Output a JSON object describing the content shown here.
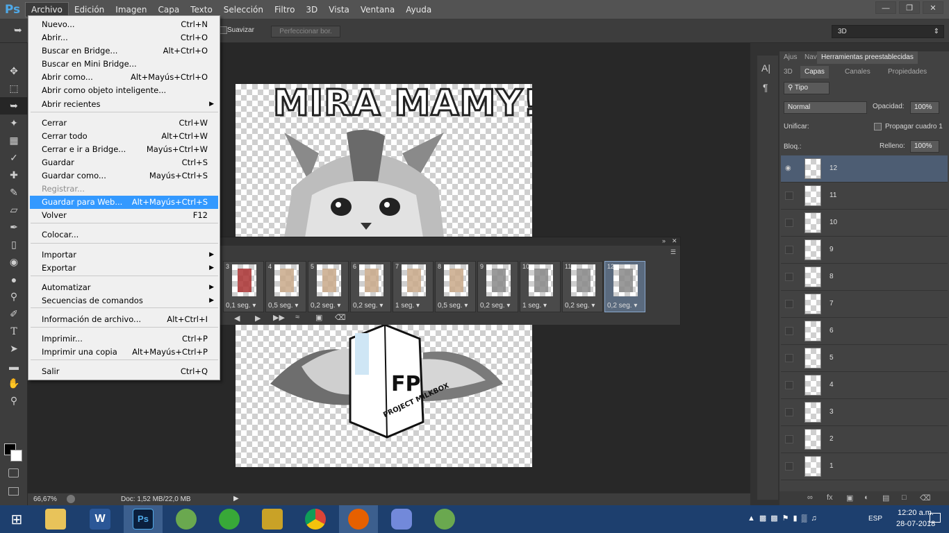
{
  "app": {
    "logo": "Ps"
  },
  "menubar": [
    "Archivo",
    "Edición",
    "Imagen",
    "Capa",
    "Texto",
    "Selección",
    "Filtro",
    "3D",
    "Vista",
    "Ventana",
    "Ayuda"
  ],
  "options": {
    "smooth": "Suavizar",
    "refine": "Perfeccionar bor.",
    "workspace": "3D"
  },
  "file_menu": {
    "items": [
      {
        "label": "Nuevo...",
        "shortcut": "Ctrl+N"
      },
      {
        "label": "Abrir...",
        "shortcut": "Ctrl+O"
      },
      {
        "label": "Buscar en Bridge...",
        "shortcut": "Alt+Ctrl+O"
      },
      {
        "label": "Buscar en Mini Bridge...",
        "shortcut": ""
      },
      {
        "label": "Abrir como...",
        "shortcut": "Alt+Mayús+Ctrl+O"
      },
      {
        "label": "Abrir como objeto inteligente...",
        "shortcut": ""
      },
      {
        "label": "Abrir recientes",
        "shortcut": ""
      },
      {
        "label": "Cerrar",
        "shortcut": "Ctrl+W"
      },
      {
        "label": "Cerrar todo",
        "shortcut": "Alt+Ctrl+W"
      },
      {
        "label": "Cerrar e ir a Bridge...",
        "shortcut": "Mayús+Ctrl+W"
      },
      {
        "label": "Guardar",
        "shortcut": "Ctrl+S"
      },
      {
        "label": "Guardar como...",
        "shortcut": "Mayús+Ctrl+S"
      },
      {
        "label": "Registrar...",
        "shortcut": ""
      },
      {
        "label": "Guardar para Web...",
        "shortcut": "Alt+Mayús+Ctrl+S"
      },
      {
        "label": "Volver",
        "shortcut": "F12"
      },
      {
        "label": "Colocar...",
        "shortcut": ""
      },
      {
        "label": "Importar",
        "shortcut": ""
      },
      {
        "label": "Exportar",
        "shortcut": ""
      },
      {
        "label": "Automatizar",
        "shortcut": ""
      },
      {
        "label": "Secuencias de comandos",
        "shortcut": ""
      },
      {
        "label": "Información de archivo...",
        "shortcut": "Alt+Ctrl+I"
      },
      {
        "label": "Imprimir...",
        "shortcut": "Ctrl+P"
      },
      {
        "label": "Imprimir una copia",
        "shortcut": "Alt+Mayús+Ctrl+P"
      },
      {
        "label": "Salir",
        "shortcut": "Ctrl+Q"
      }
    ],
    "highlighted": "Guardar para Web...",
    "disabled": "Registrar..."
  },
  "artwork": {
    "title": "MIRA MAMY!",
    "box_text": "PROJECT MILKBOX"
  },
  "timeline": {
    "frames": [
      {
        "num": "3",
        "delay": "0,1 seg."
      },
      {
        "num": "4",
        "delay": "0,5 seg."
      },
      {
        "num": "5",
        "delay": "0,2 seg."
      },
      {
        "num": "6",
        "delay": "0,2 seg."
      },
      {
        "num": "7",
        "delay": "1 seg."
      },
      {
        "num": "8",
        "delay": "0,5 seg."
      },
      {
        "num": "9",
        "delay": "0,2 seg."
      },
      {
        "num": "10",
        "delay": "1 seg."
      },
      {
        "num": "11",
        "delay": "0,2 seg."
      },
      {
        "num": "12",
        "delay": "0,2 seg."
      }
    ]
  },
  "status": {
    "zoom": "66,67%",
    "doc": "Doc: 1,52 MB/22,0 MB"
  },
  "panel": {
    "tabs_top": [
      "Ajus",
      "Nav",
      "Herramientas preestablecidas"
    ],
    "tabs": [
      "3D",
      "Capas",
      "Canales",
      "Propiedades"
    ],
    "filter": "Tipo",
    "blend": "Normal",
    "opacity_label": "Opacidad:",
    "opacity": "100%",
    "unify_label": "Unificar:",
    "propagate": "Propagar cuadro 1",
    "lock_label": "Bloq.:",
    "fill_label": "Relleno:",
    "fill": "100%",
    "layers": [
      "12",
      "11",
      "10",
      "9",
      "8",
      "7",
      "6",
      "5",
      "4",
      "3",
      "2",
      "1"
    ]
  },
  "taskbar": {
    "lang": "ESP",
    "time": "12:20 a.m.",
    "date": "28-07-2018"
  }
}
